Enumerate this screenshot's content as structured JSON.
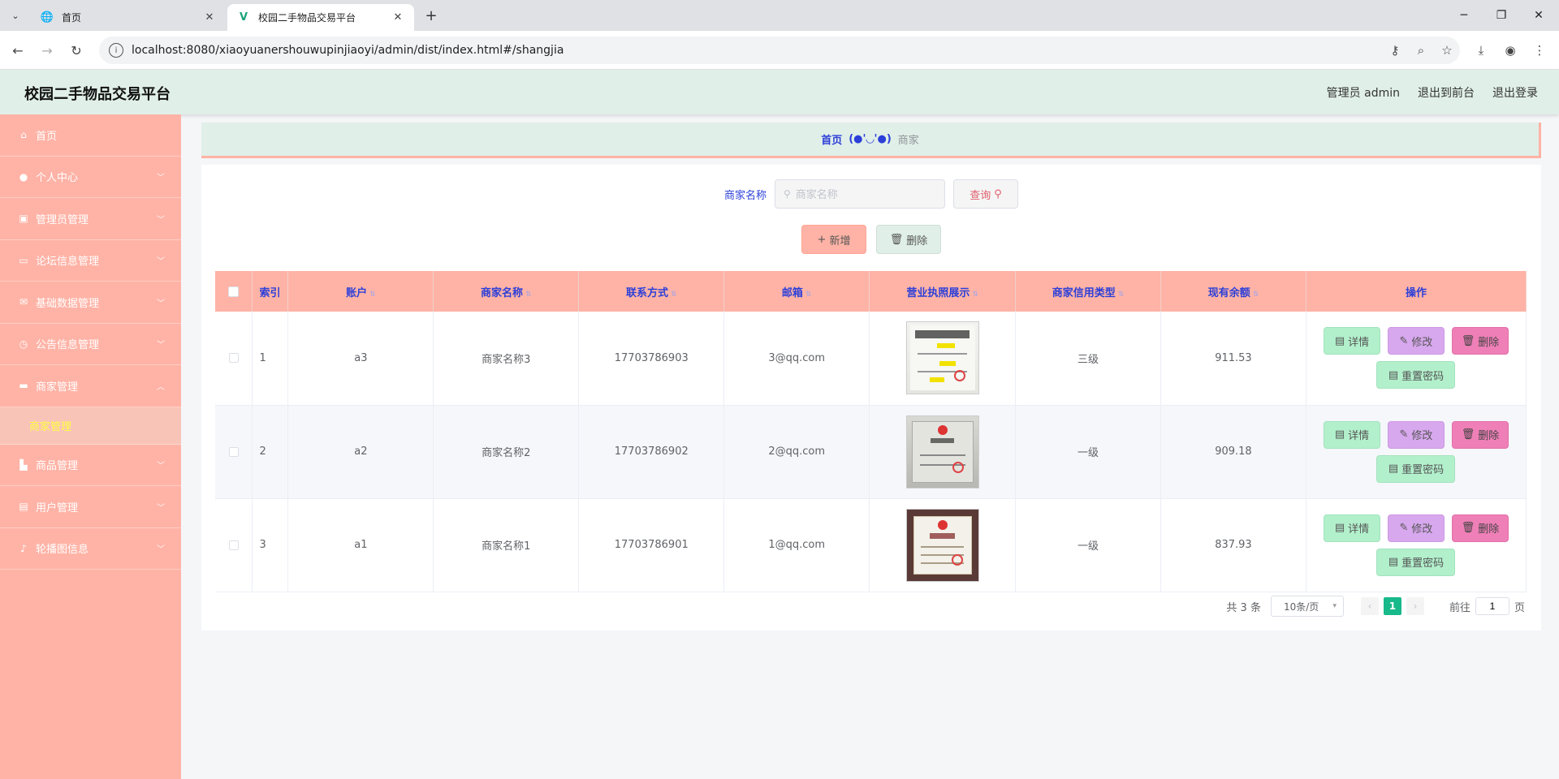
{
  "browser": {
    "tabs": [
      {
        "title": "首页",
        "active": false
      },
      {
        "title": "校园二手物品交易平台",
        "active": true
      }
    ],
    "url": "localhost:8080/xiaoyuanershouwupinjiaoyi/admin/dist/index.html#/shangjia"
  },
  "header": {
    "title": "校园二手物品交易平台",
    "user": "管理员 admin",
    "to_front": "退出到前台",
    "logout": "退出登录"
  },
  "sidebar": {
    "items": [
      {
        "label": "首页",
        "icon": "home-icon"
      },
      {
        "label": "个人中心",
        "icon": "user-icon"
      },
      {
        "label": "管理员管理",
        "icon": "chart-icon"
      },
      {
        "label": "论坛信息管理",
        "icon": "card-icon"
      },
      {
        "label": "基础数据管理",
        "icon": "mail-icon"
      },
      {
        "label": "公告信息管理",
        "icon": "clock-icon"
      },
      {
        "label": "商家管理",
        "icon": "shop-icon"
      },
      {
        "label": "商品管理",
        "icon": "goods-icon"
      },
      {
        "label": "用户管理",
        "icon": "bag-icon"
      },
      {
        "label": "轮播图信息",
        "icon": "mic-icon"
      }
    ],
    "sub_item": "商家管理"
  },
  "breadcrumb": {
    "home": "首页",
    "separator": "(●'◡'●)",
    "current": "商家"
  },
  "search": {
    "label": "商家名称",
    "placeholder": "商家名称",
    "query_button": "查询"
  },
  "actions": {
    "add": "新增",
    "delete": "删除"
  },
  "table": {
    "headers": [
      "索引",
      "账户",
      "商家名称",
      "联系方式",
      "邮箱",
      "营业执照展示",
      "商家信用类型",
      "现有余额",
      "操作"
    ],
    "rows": [
      {
        "index": "1",
        "account": "a3",
        "name": "商家名称3",
        "phone": "17703786903",
        "email": "3@qq.com",
        "credit": "三级",
        "balance": "911.53"
      },
      {
        "index": "2",
        "account": "a2",
        "name": "商家名称2",
        "phone": "17703786902",
        "email": "2@qq.com",
        "credit": "一级",
        "balance": "909.18"
      },
      {
        "index": "3",
        "account": "a1",
        "name": "商家名称1",
        "phone": "17703786901",
        "email": "1@qq.com",
        "credit": "一级",
        "balance": "837.93"
      }
    ],
    "op_labels": {
      "detail": "详情",
      "edit": "修改",
      "delete": "删除",
      "reset": "重置密码"
    }
  },
  "pagination": {
    "total": "共 3 条",
    "page_size": "10条/页",
    "current_page": "1",
    "goto_label": "前往",
    "goto_value": "1",
    "page_suffix": "页"
  },
  "colors": {
    "sidebar": "#ffb3a6",
    "header": "#e0efe8",
    "accent_text": "#2c3fd8",
    "pager_active": "#18b98a"
  }
}
